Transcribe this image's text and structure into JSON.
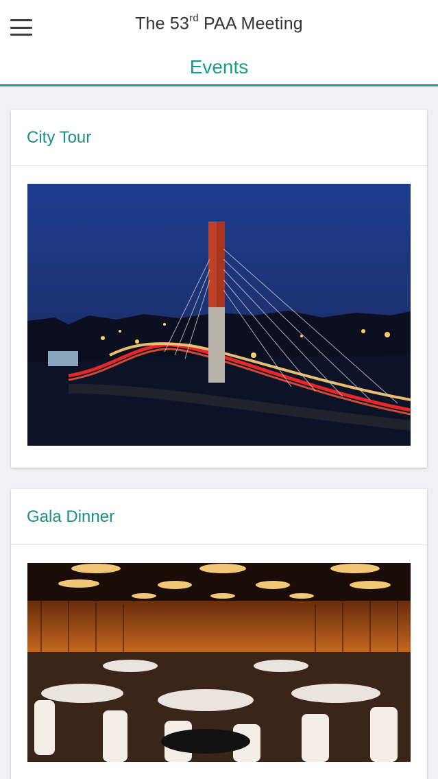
{
  "header": {
    "title_prefix": "The 53",
    "title_sup": "rd",
    "title_suffix": " PAA Meeting",
    "tab": "Events",
    "accent": "#1b9a8a"
  },
  "events": [
    {
      "title": "City Tour",
      "image_desc": "night-bridge-photo"
    },
    {
      "title": "Gala Dinner",
      "image_desc": "banquet-hall-photo"
    }
  ]
}
